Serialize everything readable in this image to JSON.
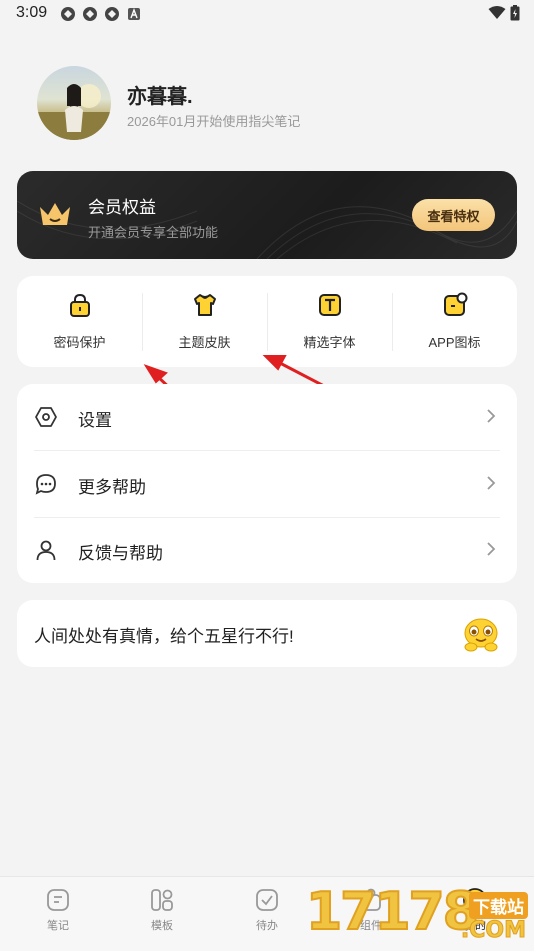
{
  "status_bar": {
    "time": "3:09"
  },
  "profile": {
    "name": "亦暮暮.",
    "since": "2026年01月开始使用指尖笔记"
  },
  "vip": {
    "title": "会员权益",
    "subtitle": "开通会员专享全部功能",
    "button": "查看特权",
    "accent": "#f3c57a"
  },
  "features": [
    {
      "label": "密码保护",
      "icon": "lock-icon"
    },
    {
      "label": "主题皮肤",
      "icon": "tshirt-icon"
    },
    {
      "label": "精选字体",
      "icon": "font-t-icon"
    },
    {
      "label": "APP图标",
      "icon": "app-icon"
    }
  ],
  "menu": [
    {
      "label": "设置",
      "icon": "settings-hexagon-icon"
    },
    {
      "label": "更多帮助",
      "icon": "chat-bubble-icon"
    },
    {
      "label": "反馈与帮助",
      "icon": "person-icon"
    }
  ],
  "rate": {
    "text": "人间处处有真情，给个五星行不行!",
    "icon": "smiley-face-icon"
  },
  "bottom_nav": [
    {
      "label": "笔记",
      "icon": "note-icon"
    },
    {
      "label": "模板",
      "icon": "template-icon"
    },
    {
      "label": "待办",
      "icon": "todo-check-icon"
    },
    {
      "label": "组件",
      "icon": "widget-icon"
    },
    {
      "label": "我的",
      "icon": "profile-smile-icon"
    }
  ],
  "watermark": {
    "number": "17178",
    "top": "下载站",
    "bottom": ".COM"
  }
}
